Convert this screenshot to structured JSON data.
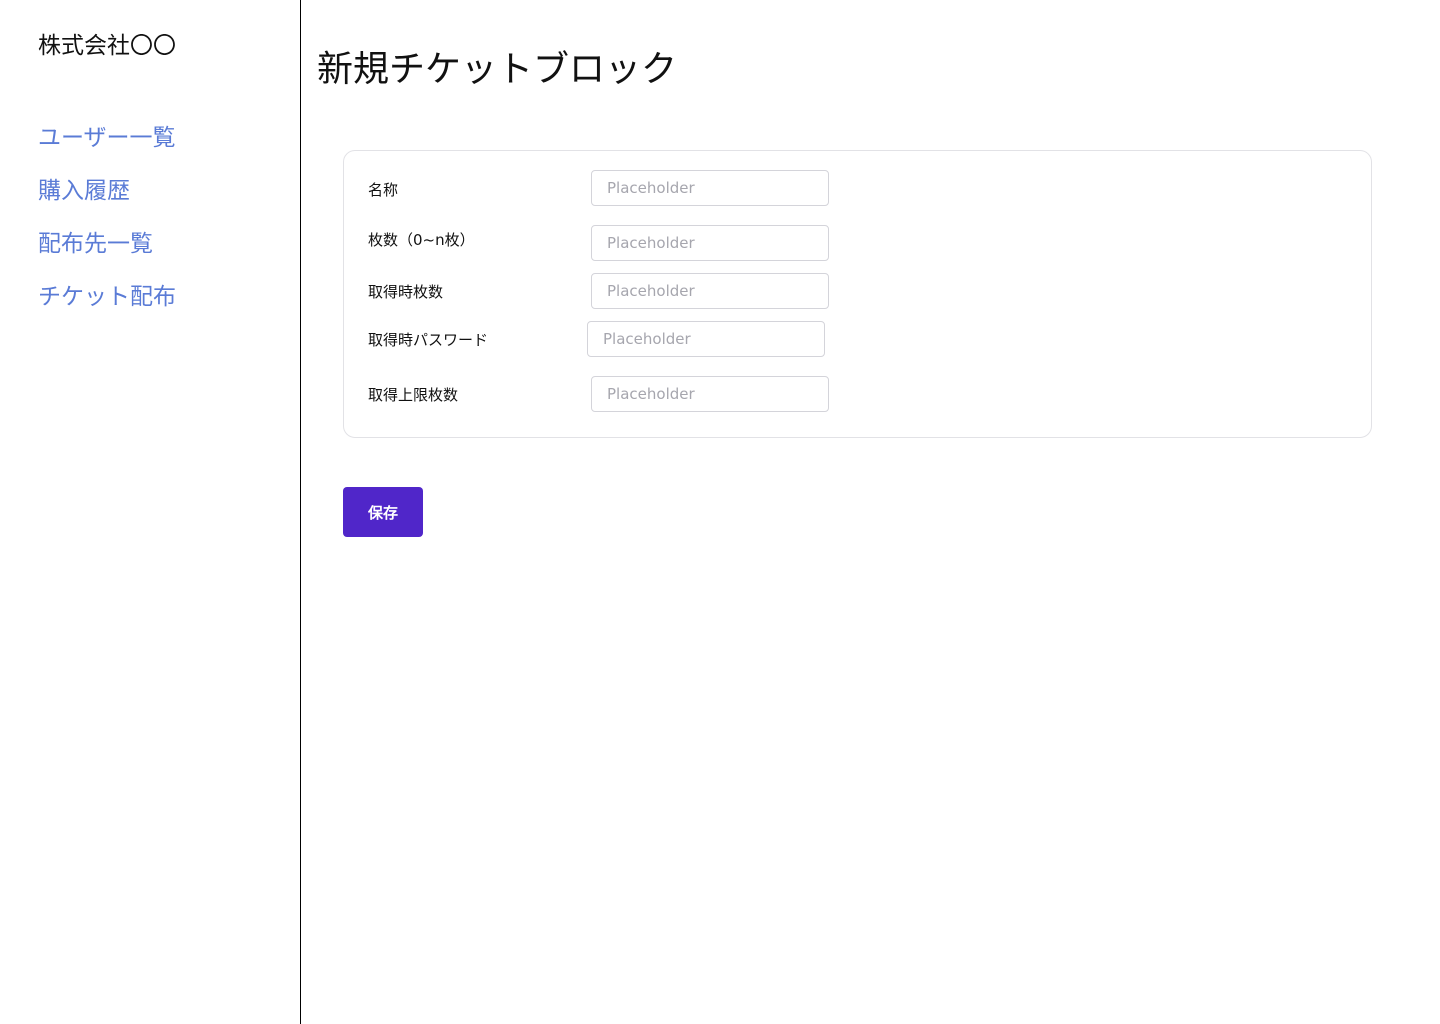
{
  "sidebar": {
    "company_name": "株式会社〇〇",
    "nav_items": [
      {
        "label": "ユーザー一覧"
      },
      {
        "label": "購入履歴"
      },
      {
        "label": "配布先一覧"
      },
      {
        "label": "チケット配布"
      }
    ],
    "link_color": "#5a7bd6"
  },
  "main": {
    "title": "新規チケットブロック",
    "form": {
      "fields": [
        {
          "label": "名称",
          "value": "",
          "placeholder": "Placeholder"
        },
        {
          "label": "枚数（0~n枚）",
          "value": "",
          "placeholder": "Placeholder"
        },
        {
          "label": "取得時枚数",
          "value": "",
          "placeholder": "Placeholder"
        },
        {
          "label": "取得時パスワード",
          "value": "",
          "placeholder": "Placeholder"
        },
        {
          "label": "取得上限枚数",
          "value": "",
          "placeholder": "Placeholder"
        }
      ]
    },
    "save_label": "保存",
    "accent_color": "#5026c9"
  }
}
